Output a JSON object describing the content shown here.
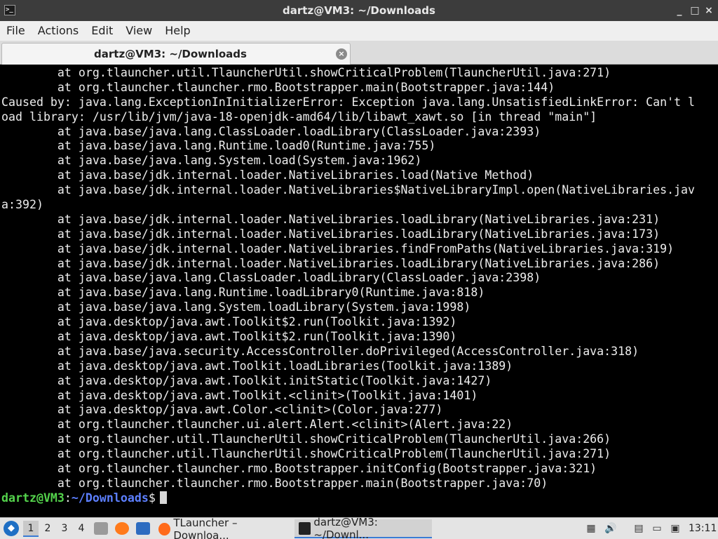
{
  "window": {
    "title": "dartz@VM3: ~/Downloads",
    "controls": {
      "minimize": "_",
      "maximize": "□",
      "close": "×"
    }
  },
  "menu": [
    "File",
    "Actions",
    "Edit",
    "View",
    "Help"
  ],
  "tab": {
    "label": "dartz@VM3: ~/Downloads",
    "close": "×"
  },
  "terminal": {
    "lines": [
      "        at org.tlauncher.util.TlauncherUtil.showCriticalProblem(TlauncherUtil.java:271)",
      "        at org.tlauncher.tlauncher.rmo.Bootstrapper.main(Bootstrapper.java:144)",
      "Caused by: java.lang.ExceptionInInitializerError: Exception java.lang.UnsatisfiedLinkError: Can't l",
      "oad library: /usr/lib/jvm/java-18-openjdk-amd64/lib/libawt_xawt.so [in thread \"main\"]",
      "        at java.base/java.lang.ClassLoader.loadLibrary(ClassLoader.java:2393)",
      "        at java.base/java.lang.Runtime.load0(Runtime.java:755)",
      "        at java.base/java.lang.System.load(System.java:1962)",
      "        at java.base/jdk.internal.loader.NativeLibraries.load(Native Method)",
      "        at java.base/jdk.internal.loader.NativeLibraries$NativeLibraryImpl.open(NativeLibraries.jav",
      "a:392)",
      "        at java.base/jdk.internal.loader.NativeLibraries.loadLibrary(NativeLibraries.java:231)",
      "        at java.base/jdk.internal.loader.NativeLibraries.loadLibrary(NativeLibraries.java:173)",
      "        at java.base/jdk.internal.loader.NativeLibraries.findFromPaths(NativeLibraries.java:319)",
      "        at java.base/jdk.internal.loader.NativeLibraries.loadLibrary(NativeLibraries.java:286)",
      "        at java.base/java.lang.ClassLoader.loadLibrary(ClassLoader.java:2398)",
      "        at java.base/java.lang.Runtime.loadLibrary0(Runtime.java:818)",
      "        at java.base/java.lang.System.loadLibrary(System.java:1998)",
      "        at java.desktop/java.awt.Toolkit$2.run(Toolkit.java:1392)",
      "        at java.desktop/java.awt.Toolkit$2.run(Toolkit.java:1390)",
      "        at java.base/java.security.AccessController.doPrivileged(AccessController.java:318)",
      "        at java.desktop/java.awt.Toolkit.loadLibraries(Toolkit.java:1389)",
      "        at java.desktop/java.awt.Toolkit.initStatic(Toolkit.java:1427)",
      "        at java.desktop/java.awt.Toolkit.<clinit>(Toolkit.java:1401)",
      "        at java.desktop/java.awt.Color.<clinit>(Color.java:277)",
      "        at org.tlauncher.tlauncher.ui.alert.Alert.<clinit>(Alert.java:22)",
      "        at org.tlauncher.util.TlauncherUtil.showCriticalProblem(TlauncherUtil.java:266)",
      "        at org.tlauncher.util.TlauncherUtil.showCriticalProblem(TlauncherUtil.java:271)",
      "        at org.tlauncher.tlauncher.rmo.Bootstrapper.initConfig(Bootstrapper.java:321)",
      "        at org.tlauncher.tlauncher.rmo.Bootstrapper.main(Bootstrapper.java:70)"
    ],
    "prompt": {
      "user_host": "dartz@VM3",
      "sep": ":",
      "path": "~/Downloads",
      "symbol": "$"
    }
  },
  "taskbar": {
    "workspaces": [
      "1",
      "2",
      "3",
      "4"
    ],
    "active_workspace": "1",
    "tasks": [
      {
        "label": "TLauncher – Downloa...",
        "icon": "firefox-icon"
      },
      {
        "label": "dartz@VM3: ~/Downl...",
        "icon": "terminal-icon"
      }
    ],
    "clock": "13:11"
  },
  "colors": {
    "prompt_user": "#54d34c",
    "prompt_path": "#5c7fff",
    "terminal_bg": "#000000",
    "terminal_fg": "#ededed"
  }
}
